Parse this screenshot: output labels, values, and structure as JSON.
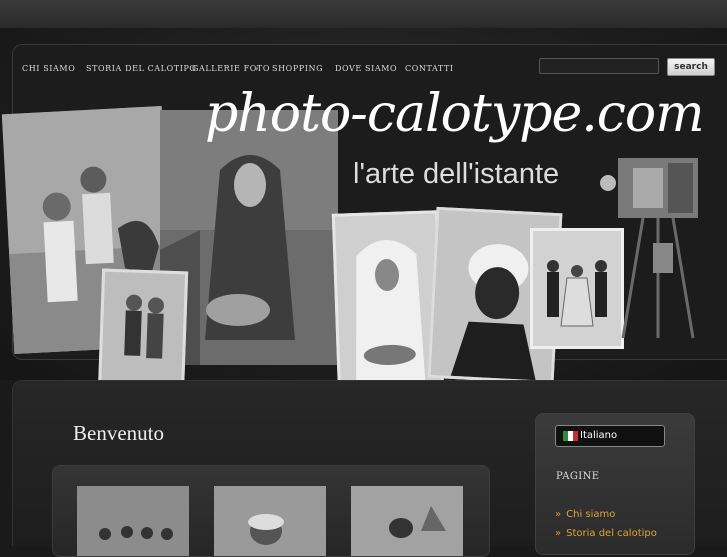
{
  "nav": {
    "items": [
      {
        "label": "Chi siamo"
      },
      {
        "label": "Storia del calotipo"
      },
      {
        "label": "Gallerie foto",
        "has_submenu": true
      },
      {
        "label": "Shopping"
      },
      {
        "label": "Dove siamo"
      },
      {
        "label": "Contatti"
      }
    ]
  },
  "search": {
    "placeholder": "",
    "button_label": "search"
  },
  "header": {
    "logo_text": "photo-calotype.com",
    "tagline": "l'arte dell'istante"
  },
  "main": {
    "title": "Benvenuto"
  },
  "sidebar": {
    "language": {
      "label": "Italiano",
      "flag_colors": [
        "#2e8b3d",
        "#ffffff",
        "#c8302c"
      ]
    },
    "pages_title": "PAGINE",
    "links": [
      {
        "label": "Chi siamo"
      },
      {
        "label": "Storia del calotipo"
      }
    ]
  },
  "colors": {
    "accent_link": "#e0a238",
    "background": "#1a1a1a"
  }
}
